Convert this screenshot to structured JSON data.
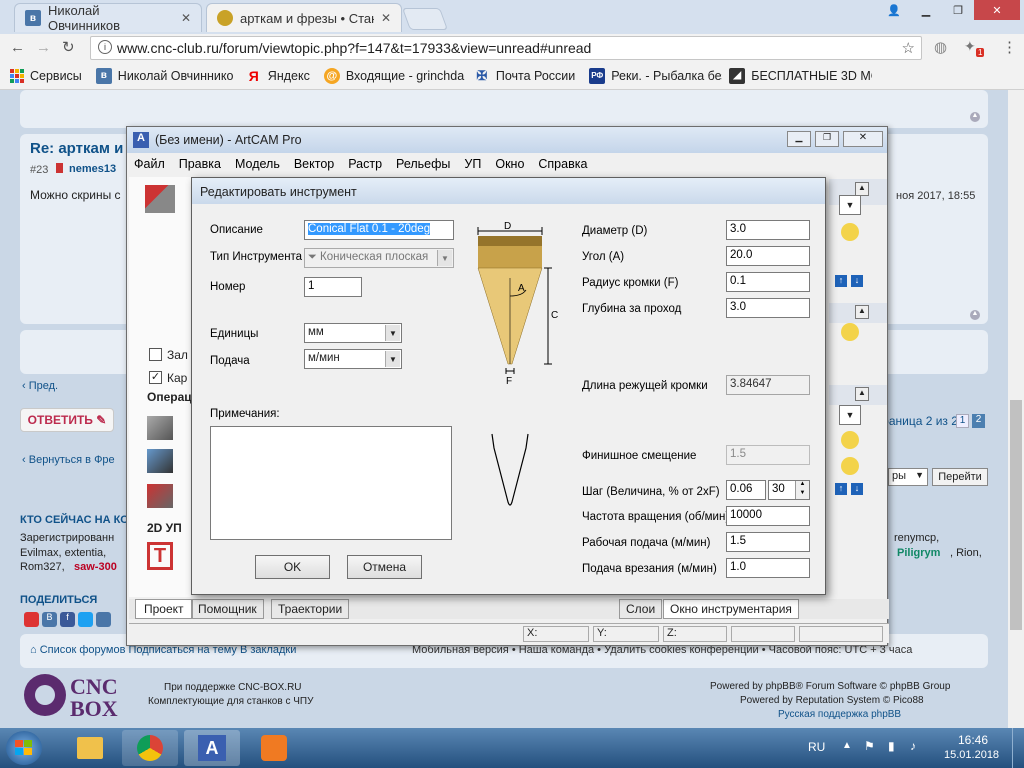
{
  "browser": {
    "tabs": [
      {
        "label": "Николай Овчинников"
      },
      {
        "label": "арткам и фрезы • Станк"
      }
    ],
    "url": "www.cnc-club.ru/forum/viewtopic.php?f=147&t=17933&view=unread#unread",
    "bookmarks": [
      {
        "label": "Сервисы"
      },
      {
        "label": "Николай Овчиннико"
      },
      {
        "label": "Яндекс"
      },
      {
        "label": "Входящие - grinchda"
      },
      {
        "label": "Почта России"
      },
      {
        "label": "Реки. - Рыбалка без"
      },
      {
        "label": "БЕСПЛАТНЫЕ 3D МС"
      }
    ],
    "ext_badge": "1"
  },
  "forum": {
    "post_title": "Re: арткам и",
    "post_num": "#23",
    "post_author": "nemes13",
    "post_text": "Можно скрины с",
    "post_date": "ноя 2017, 18:55",
    "prev_link": "Пред.",
    "reply_button": "ОТВЕТИТЬ",
    "pagination": "Страница 2 из 2 •",
    "page_1": "1",
    "page_2": "2",
    "back_link": "Вернуться в Фре",
    "jump_select": "ры",
    "go_button": "Перейти",
    "who_online": "КТО СЕЙЧАС НА КО",
    "registered": "Зарегистрированн",
    "users_line1": "Evilmax, extentia,",
    "users_line2_a": "Rom327,",
    "users_line2_b": "saw-300",
    "users_right1": "renymcp,",
    "users_right2_a": "Piligrym",
    "users_right2_b": ", Rion,",
    "share": "ПОДЕЛИТЬСЯ",
    "footer_links": "Список форумов   Подписаться на тему   В закладки",
    "footer_right": "Мобильная версия • Наша команда • Удалить cookies конференции • Часовой пояс: UTC + 3 часа",
    "logo_top": "CNC",
    "logo_bottom": "BOX",
    "support1": "При поддержке CNC-BOX.RU",
    "support2": "Комплектующие для станков с ЧПУ",
    "powered1": "Powered by phpBB® Forum Software © phpBB Group",
    "powered2": "Powered by Reputation System © Pico88",
    "powered3": "Русская поддержка phpBB"
  },
  "artcam": {
    "title": "(Без имени) - ArtCAM Pro",
    "menu": [
      "Файл",
      "Правка",
      "Модель",
      "Вектор",
      "Растр",
      "Рельефы",
      "УП",
      "Окно",
      "Справка"
    ],
    "checkbox1": "Зал",
    "checkbox2": "Кар",
    "ops_header": "Операц",
    "section_2d": "2D УП",
    "tabs": [
      "Проект",
      "Помощник",
      "Траектории"
    ],
    "tabs_right": [
      "Слои",
      "Окно инструментария"
    ],
    "status": [
      "X:",
      "Y:",
      "Z:"
    ]
  },
  "dialog": {
    "title": "Редактировать инструмент",
    "description_label": "Описание",
    "description_value": "Conical Flat 0.1 - 20deg",
    "tooltype_label": "Тип Инструмента",
    "tooltype_value": "Коническая плоская",
    "number_label": "Номер",
    "number_value": "1",
    "units_label": "Единицы",
    "units_value": "мм",
    "feed_label": "Подача",
    "feed_value": "м/мин",
    "notes_label": "Примечания:",
    "ok_button": "OK",
    "cancel_button": "Отмена",
    "diagram_labels": {
      "d": "D",
      "a": "A",
      "c": "C",
      "f": "F"
    },
    "diameter_label": "Диаметр (D)",
    "diameter_value": "3.0",
    "angle_label": "Угол (A)",
    "angle_value": "20.0",
    "radius_label": "Радиус кромки (F)",
    "radius_value": "0.1",
    "depth_label": "Глубина за проход",
    "depth_value": "3.0",
    "cut_length_label": "Длина режущей кромки",
    "cut_length_value": "3.84647",
    "finish_offset_label": "Финишное смещение",
    "finish_offset_value": "1.5",
    "stepover_label": "Шаг (Величина, % от 2xF)",
    "stepover_value": "0.06",
    "stepover_percent": "30",
    "spindle_label": "Частота вращения (об/мин)",
    "spindle_value": "10000",
    "feed_rate_label": "Рабочая подача (м/мин)",
    "feed_rate_value": "1.5",
    "plunge_label": "Подача врезания (м/мин)",
    "plunge_value": "1.0"
  },
  "taskbar": {
    "lang": "RU",
    "time": "16:46",
    "date": "15.01.2018"
  },
  "colors": {
    "accent": "#105289",
    "danger": "#bc2a4d",
    "tool_fill": "#e8c878",
    "selection": "#3399ff"
  }
}
